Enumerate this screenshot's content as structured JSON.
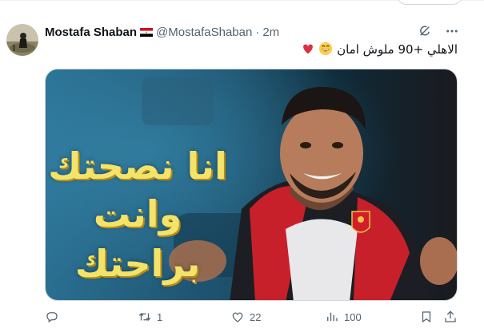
{
  "tweet": {
    "author_name": "Mostafa Shaban",
    "handle": "@MostafaShaban",
    "separator": "·",
    "time": "2m",
    "text": "الاهلي +90 ملوش امان",
    "emojis": [
      "grinning-face",
      "red-heart"
    ]
  },
  "media": {
    "caption_line1": "انا نصحتك",
    "caption_line2": "وانت براحتك"
  },
  "actions": {
    "replies": "",
    "retweets": "1",
    "likes": "22",
    "views": "100"
  },
  "icons": {
    "flag": "egypt-flag-icon",
    "grok": "grok-icon",
    "more": "more-icon",
    "reply": "reply-icon",
    "retweet": "retweet-icon",
    "like": "heart-icon",
    "views": "views-icon",
    "bookmark": "bookmark-icon",
    "share": "share-icon"
  },
  "colors": {
    "text_primary": "#0f1419",
    "text_secondary": "#536471",
    "caption_yellow": "#f3e36a",
    "media_blue": "#1f6a8a"
  }
}
